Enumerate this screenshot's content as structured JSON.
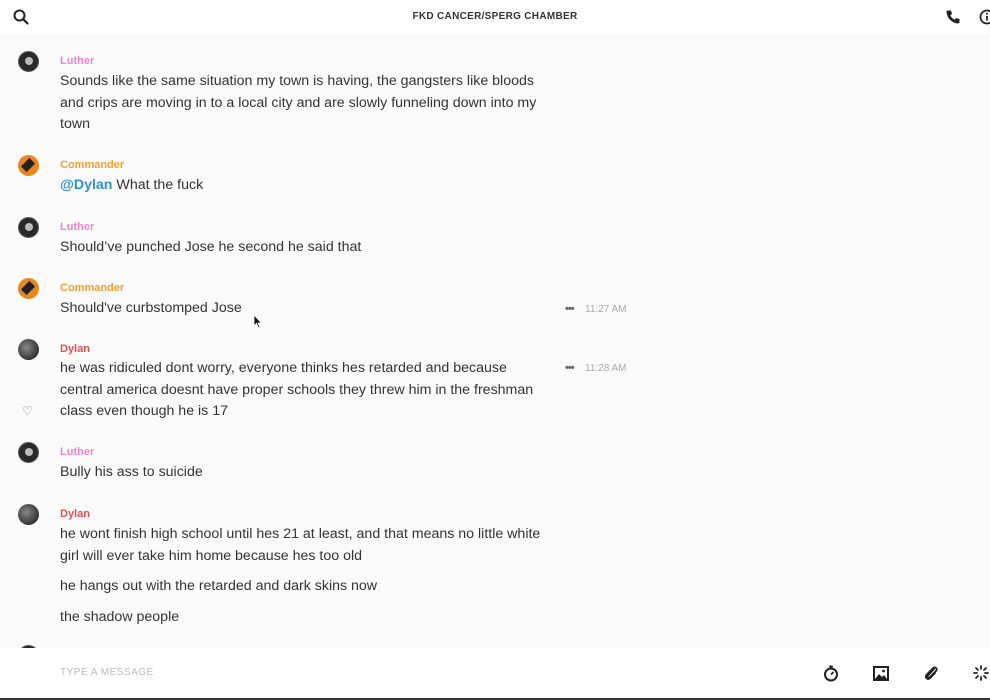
{
  "header": {
    "title": "FKD CANCER/SPERG CHAMBER"
  },
  "icons": {
    "search": "search-icon",
    "call": "phone-icon",
    "info": "info-icon",
    "timer": "timer-icon",
    "image": "image-icon",
    "attach": "paperclip-icon",
    "sparkle": "sparkle-icon"
  },
  "colors": {
    "luther": "#e886c7",
    "commander": "#f0a030",
    "dylan": "#e05050",
    "mention": "#2a94d6"
  },
  "messages": [
    {
      "author": "Luther",
      "lines": [
        "Sounds like the same situation my town is having, the gangsters like bloods",
        "and crips are moving in to a local city and are slowly funneling down into my",
        "town"
      ]
    },
    {
      "author": "Commander",
      "mention": "@Dylan",
      "text": " What the fuck"
    },
    {
      "author": "Luther",
      "text": "Should’ve punched Jose he second he said that"
    },
    {
      "author": "Commander",
      "text": "Should've curbstomped Jose",
      "more": "•••",
      "time": "11:27 AM"
    },
    {
      "author": "Dylan",
      "lines": [
        "he was ridiculed dont worry, everyone thinks hes retarded and because",
        "central america doesnt have proper schools they threw him in the freshman",
        "class even though he is 17"
      ],
      "more": "•••",
      "time": "11:28 AM",
      "heart": "♡"
    },
    {
      "author": "Luther",
      "text": "Bully his ass to suicide"
    },
    {
      "author": "Dylan",
      "lines": [
        "he wont finish high school until hes 21 at least, and that means no little white",
        "girl will ever take him home because hes too old"
      ],
      "extra": [
        "he hangs out with the retarded and dark skins now",
        "the shadow people"
      ]
    }
  ],
  "composer": {
    "placeholder": "TYPE A MESSAGE",
    "value": ""
  }
}
